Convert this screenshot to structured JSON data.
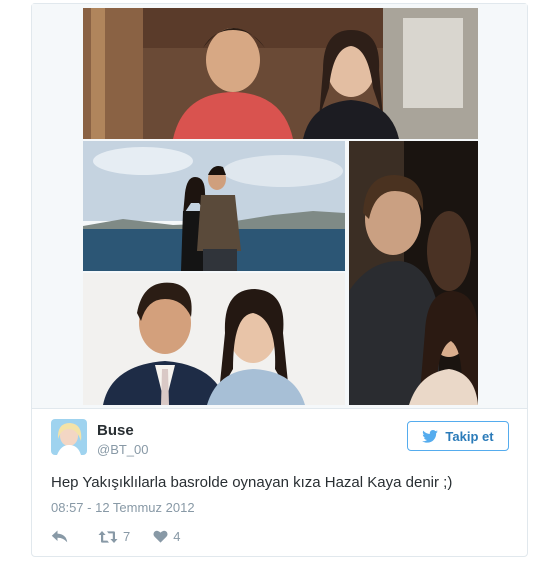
{
  "tweet": {
    "author": {
      "name": "Buse",
      "handle": "@BT_00",
      "avatar": "avatar-photo"
    },
    "follow_button": {
      "label": "Takip et",
      "icon": "twitter-bird-icon"
    },
    "text": "Hep Yakışıklılarla basrolde oynayan kıza Hazal Kaya denir ;)",
    "timestamp": "08:57 - 12 Temmuz 2012",
    "actions": {
      "reply": {
        "icon": "reply-icon"
      },
      "retweet": {
        "icon": "retweet-icon",
        "count": "7"
      },
      "like": {
        "icon": "heart-icon",
        "count": "4"
      }
    }
  },
  "media": {
    "photo_count": 4
  },
  "colors": {
    "accent": "#55acee",
    "accent_text": "#2b7bb9",
    "muted_text": "#8899a6",
    "body_text": "#292f33",
    "border": "#e1e8ed"
  }
}
